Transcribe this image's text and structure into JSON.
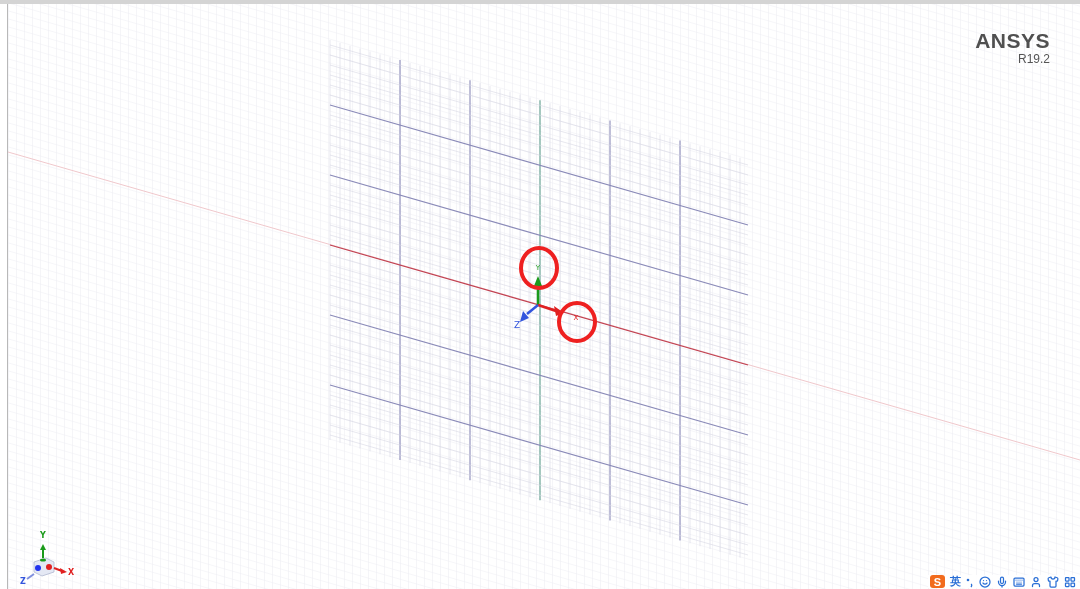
{
  "logo": {
    "name": "ANSYS",
    "version": "R19.2"
  },
  "origin_axes": {
    "labels": [
      {
        "kind": "y",
        "text": "Y"
      },
      {
        "kind": "x",
        "text": "X"
      },
      {
        "kind": "z",
        "text": "Z"
      }
    ]
  },
  "triad": {
    "labels": [
      {
        "kind": "y",
        "text": "Y"
      },
      {
        "kind": "x",
        "text": "X"
      },
      {
        "kind": "z",
        "text": "Z"
      }
    ]
  },
  "ime_toolbar": {
    "logo_letter": "S",
    "mode": "英"
  }
}
